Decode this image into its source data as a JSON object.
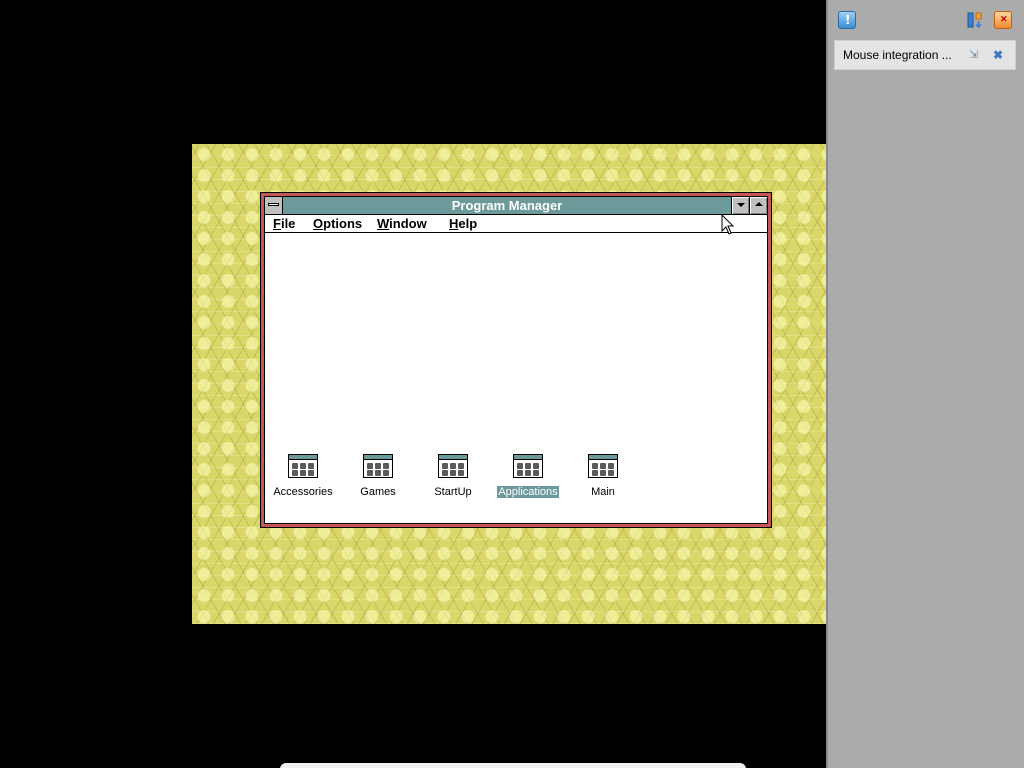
{
  "program_manager": {
    "title": "Program Manager",
    "menu": [
      {
        "accel": "F",
        "rest": "ile"
      },
      {
        "accel": "O",
        "rest": "ptions"
      },
      {
        "accel": "W",
        "rest": "indow"
      },
      {
        "accel": "H",
        "rest": "elp"
      }
    ],
    "groups": [
      {
        "label": "Accessories",
        "selected": false
      },
      {
        "label": "Games",
        "selected": false
      },
      {
        "label": "StartUp",
        "selected": false
      },
      {
        "label": "Applications",
        "selected": true
      },
      {
        "label": "Main",
        "selected": false
      }
    ]
  },
  "host_panel": {
    "notification_text": "Mouse integration ...",
    "icons": {
      "notify": "notification-icon",
      "details": "details-icon",
      "close_all": "close-all-icon",
      "pin": "pin-icon",
      "dismiss": "dismiss-icon"
    }
  },
  "colors": {
    "title_bar": "#6c9a9a",
    "window_frame": "#c05858",
    "desktop_wallpaper": "#d9d66a",
    "host_panel": "#ababab",
    "selection": "#6c9a9a"
  }
}
